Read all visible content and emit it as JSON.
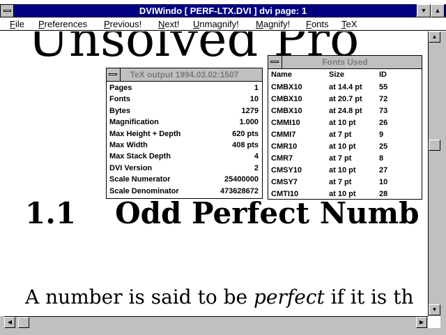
{
  "window": {
    "title": "DVIWindo  [ PERF-LTX.DVI ]   dvi page:  1",
    "minimize_glyph": "▼",
    "maximize_glyph": "▲"
  },
  "menu": [
    "File",
    "Preferences",
    "Previous!",
    "Next!",
    "Unmagnify!",
    "Magnify!",
    "Fonts",
    "TeX"
  ],
  "document": {
    "heading_top": "Unsolved Pro",
    "section_number": "1.1",
    "section_title": "Odd Perfect Numb",
    "para_prefix": "A number is said to be ",
    "para_em": "perfect",
    "para_suffix": " if it is th"
  },
  "stats_window": {
    "title": "TeX output 1994.03.02:1507",
    "rows": [
      {
        "key": "Pages",
        "value": "1"
      },
      {
        "key": "Fonts",
        "value": "10"
      },
      {
        "key": "Bytes",
        "value": "1279"
      },
      {
        "key": "Magnification",
        "value": "1.000"
      },
      {
        "key": "Max Height + Depth",
        "value": "620 pts"
      },
      {
        "key": "Max Width",
        "value": "408 pts"
      },
      {
        "key": "Max Stack Depth",
        "value": "4"
      },
      {
        "key": "DVI Version",
        "value": "2"
      },
      {
        "key": "Scale Numerator",
        "value": "25400000"
      },
      {
        "key": "Scale Denominator",
        "value": "473628672"
      }
    ]
  },
  "fonts_window": {
    "title": "Fonts Used",
    "headers": {
      "name": "Name",
      "size": "Size",
      "id": "ID"
    },
    "rows": [
      {
        "name": "CMBX10",
        "size": "at  14.4 pt",
        "id": "55"
      },
      {
        "name": "CMBX10",
        "size": "at  20.7 pt",
        "id": "72"
      },
      {
        "name": "CMBX10",
        "size": "at  24.8 pt",
        "id": "73"
      },
      {
        "name": "CMMI10",
        "size": "at  10 pt",
        "id": "26"
      },
      {
        "name": "CMMI7",
        "size": "at   7 pt",
        "id": "9"
      },
      {
        "name": "CMR10",
        "size": "at  10 pt",
        "id": "25"
      },
      {
        "name": "CMR7",
        "size": "at   7 pt",
        "id": "8"
      },
      {
        "name": "CMSY10",
        "size": "at  10 pt",
        "id": "27"
      },
      {
        "name": "CMSY7",
        "size": "at   7 pt",
        "id": "10"
      },
      {
        "name": "CMTI10",
        "size": "at  10 pt",
        "id": "28"
      }
    ]
  },
  "scroll_glyphs": {
    "up": "▲",
    "down": "▼",
    "left": "◀",
    "right": "▶"
  }
}
